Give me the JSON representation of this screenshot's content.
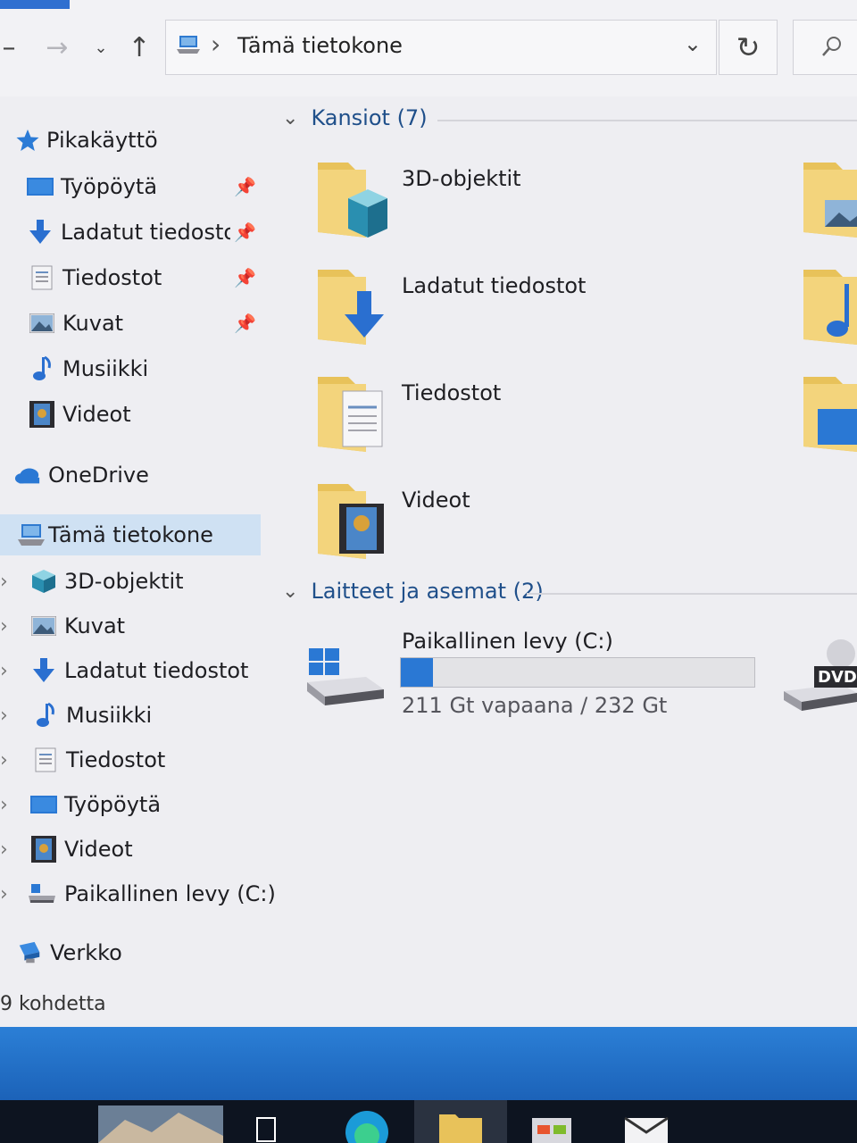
{
  "toolbar": {
    "back_icon": "arrow-left-icon",
    "forward_icon": "arrow-right-icon",
    "recent_icon": "chevron-down-icon",
    "up_icon": "arrow-up-icon",
    "refresh_icon": "refresh-icon",
    "search_icon": "search-icon"
  },
  "address": {
    "separator": "›",
    "location": "Tämä tietokone"
  },
  "sidebar": {
    "quick_access": "Pikakäyttö",
    "quick_items": [
      {
        "label": "Työpöytä",
        "icon": "desktop-icon"
      },
      {
        "label": "Ladatut tiedostot",
        "icon": "download-icon"
      },
      {
        "label": "Tiedostot",
        "icon": "documents-icon"
      },
      {
        "label": "Kuvat",
        "icon": "pictures-icon"
      },
      {
        "label": "Musiikki",
        "icon": "music-icon"
      },
      {
        "label": "Videot",
        "icon": "videos-icon"
      }
    ],
    "onedrive": "OneDrive",
    "this_pc": "Tämä tietokone",
    "pc_items": [
      {
        "label": "3D-objektit",
        "icon": "3d-objects-icon"
      },
      {
        "label": "Kuvat",
        "icon": "pictures-icon"
      },
      {
        "label": "Ladatut tiedostot",
        "icon": "download-icon"
      },
      {
        "label": "Musiikki",
        "icon": "music-icon"
      },
      {
        "label": "Tiedostot",
        "icon": "documents-icon"
      },
      {
        "label": "Työpöytä",
        "icon": "desktop-icon"
      },
      {
        "label": "Videot",
        "icon": "videos-icon"
      },
      {
        "label": "Paikallinen levy (C:)",
        "icon": "drive-icon"
      }
    ],
    "network": "Verkko"
  },
  "content": {
    "folders_header": "Kansiot (7)",
    "folders": [
      "3D-objektit",
      "Ladatut tiedostot",
      "Tiedostot",
      "Videot"
    ],
    "devices_header": "Laitteet ja asemat (2)",
    "drive": {
      "name": "Paikallinen levy (C:)",
      "space": "211 Gt vapaana / 232 Gt",
      "used_fraction": 0.09
    },
    "dvd_label": "DVD"
  },
  "status": {
    "count": "9 kohdetta"
  },
  "colors": {
    "accent": "#2a78d4",
    "selection": "#cfe1f3",
    "folder": "#e8c25a"
  }
}
